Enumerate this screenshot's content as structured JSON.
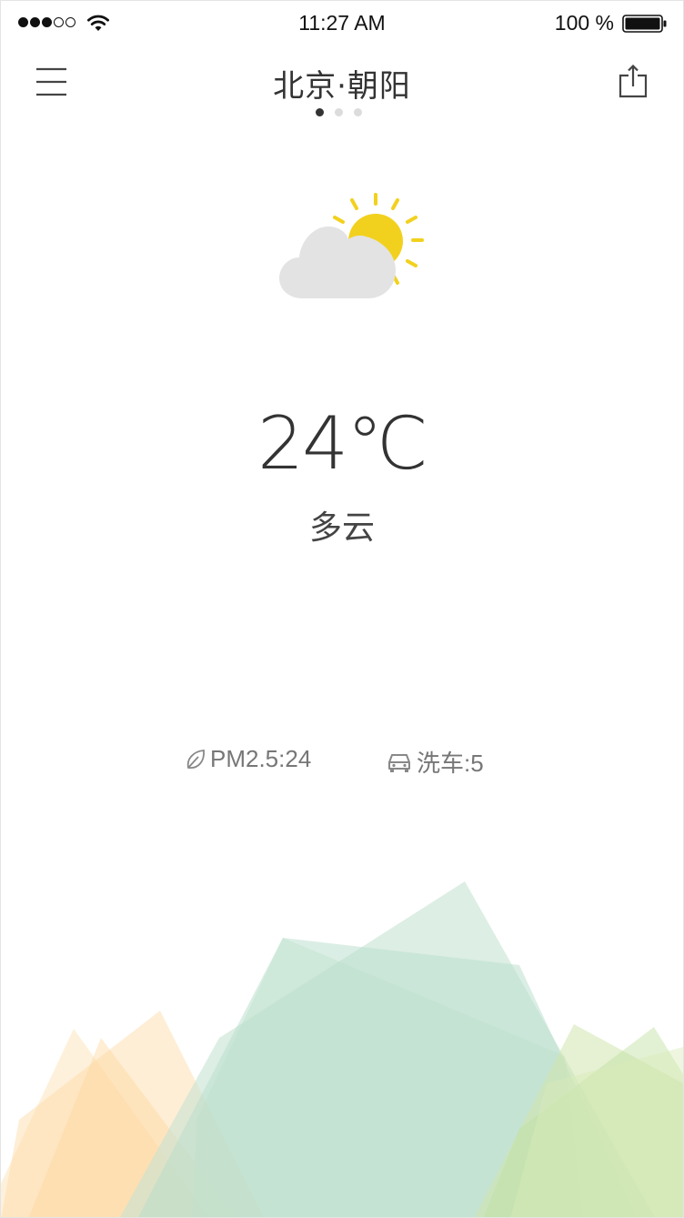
{
  "status_bar": {
    "time": "11:27 AM",
    "battery_percent": "100 %",
    "signal_icon": "signal-dots-icon",
    "wifi_icon": "wifi-icon",
    "battery_icon": "battery-icon"
  },
  "header": {
    "city": "北京·朝阳",
    "menu_icon": "menu-icon",
    "share_icon": "share-icon",
    "page_count": 3,
    "active_page": 1
  },
  "weather": {
    "icon": "partly-cloudy-icon",
    "temperature": "24℃",
    "condition": "多云"
  },
  "indices": {
    "pm25": {
      "icon": "leaf-icon",
      "label": "PM2.5:24"
    },
    "carwash": {
      "icon": "car-icon",
      "label": "洗车:5"
    }
  },
  "colors": {
    "sun": "#f2d11e",
    "cloud": "#e3e3e3",
    "mountain_orange": "#fdd9a2",
    "mountain_green": "#b8decb",
    "mountain_lime": "#cde5a6"
  }
}
